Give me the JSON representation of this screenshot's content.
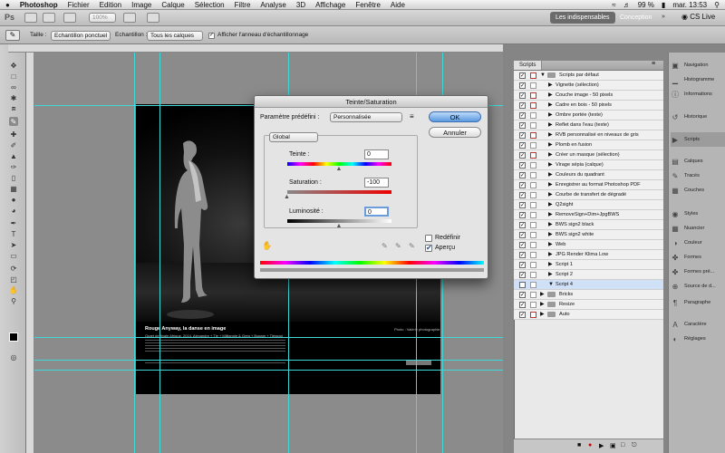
{
  "menubar": {
    "apple": "",
    "app": "Photoshop",
    "items": [
      "Fichier",
      "Edition",
      "Image",
      "Calque",
      "Sélection",
      "Filtre",
      "Analyse",
      "3D",
      "Affichage",
      "Fenêtre",
      "Aide"
    ],
    "battery": "99 %",
    "clock": "mar. 13:53"
  },
  "apptoolbar": {
    "ps_logo": "Ps",
    "zoom": "100%",
    "workspace_active": "Les indispensables",
    "workspace_other": "Conception",
    "more": "»",
    "cslive": "CS Live"
  },
  "options": {
    "size_label": "Taille :",
    "size_value": "Echantillon ponctuel",
    "sample_label": "Echantillon :",
    "sample_value": "Tous les calques",
    "ring_label": "Afficher l'anneau d'échantillonnage"
  },
  "document": {
    "caption_title": "Rouge Anyway, la danse en image",
    "caption_sub": "Quart de finale Afrique. 2014, Alexandre + Tie + Milliannie & Greg + Bogam + Tiéragui",
    "caption_right": "Photo : Valérie photographie"
  },
  "dialog": {
    "title": "Teinte/Saturation",
    "preset_label": "Paramètre prédéfini :",
    "preset_value": "Personnalisée",
    "ok": "OK",
    "cancel": "Annuler",
    "channel": "Global",
    "hue_label": "Teinte :",
    "hue_value": "0",
    "saturation_label": "Saturation :",
    "saturation_value": "-100",
    "lightness_label": "Luminosité :",
    "lightness_value": "0",
    "colorize_label": "Redéfinir",
    "preview_label": "Aperçu",
    "hue_slider": 0.5,
    "saturation_slider": 0,
    "lightness_slider": 0.5
  },
  "scripts": {
    "tab": "Scripts",
    "rows": [
      {
        "label": "Scripts par défaut",
        "level": 0,
        "type": "folder",
        "checked": true,
        "red": true
      },
      {
        "label": "Vignette (sélection)",
        "level": 1,
        "type": "item",
        "checked": true,
        "red": false
      },
      {
        "label": "Couche image - 50 pixels",
        "level": 1,
        "type": "item",
        "checked": true,
        "red": true
      },
      {
        "label": "Cadre en bois - 50 pixels",
        "level": 1,
        "type": "item",
        "checked": true,
        "red": true
      },
      {
        "label": "Ombre portée (texte)",
        "level": 1,
        "type": "item",
        "checked": true,
        "red": false
      },
      {
        "label": "Reflet dans l'eau (texte)",
        "level": 1,
        "type": "item",
        "checked": true,
        "red": false
      },
      {
        "label": "RVB personnalisé en niveaux de gris",
        "level": 1,
        "type": "item",
        "checked": true,
        "red": true
      },
      {
        "label": "Plomb en fusion",
        "level": 1,
        "type": "item",
        "checked": true,
        "red": false
      },
      {
        "label": "Créer un masque (sélection)",
        "level": 1,
        "type": "item",
        "checked": true,
        "red": true
      },
      {
        "label": "Virage sépia (calque)",
        "level": 1,
        "type": "item",
        "checked": true,
        "red": false
      },
      {
        "label": "Couleurs du quadrant",
        "level": 1,
        "type": "item",
        "checked": true,
        "red": false
      },
      {
        "label": "Enregistrer au format Photoshop PDF",
        "level": 1,
        "type": "item",
        "checked": true,
        "red": false
      },
      {
        "label": "Courbe de transfert de dégradé",
        "level": 1,
        "type": "item",
        "checked": true,
        "red": false
      },
      {
        "label": "Q2sight",
        "level": 1,
        "type": "item",
        "checked": true,
        "red": false
      },
      {
        "label": "RemoveSign+Dim+JpgBWS",
        "level": 1,
        "type": "item",
        "checked": true,
        "red": false
      },
      {
        "label": "BWS sign2 black",
        "level": 1,
        "type": "item",
        "checked": true,
        "red": false
      },
      {
        "label": "BWS sign2 white",
        "level": 1,
        "type": "item",
        "checked": true,
        "red": false
      },
      {
        "label": "Web",
        "level": 1,
        "type": "item",
        "checked": true,
        "red": false
      },
      {
        "label": "JPG Render Klima Low",
        "level": 1,
        "type": "item",
        "checked": true,
        "red": false
      },
      {
        "label": "Script 1",
        "level": 1,
        "type": "item",
        "checked": true,
        "red": false
      },
      {
        "label": "Script 2",
        "level": 1,
        "type": "item",
        "checked": true,
        "red": false
      },
      {
        "label": "Script 4",
        "level": 1,
        "type": "open",
        "checked": false,
        "red": false,
        "selected": true
      },
      {
        "label": "Bricks",
        "level": 0,
        "type": "folder",
        "checked": true,
        "red": false
      },
      {
        "label": "Resize",
        "level": 0,
        "type": "folder",
        "checked": true,
        "red": false
      },
      {
        "label": "Auto",
        "level": 0,
        "type": "folder",
        "checked": true,
        "red": true
      }
    ]
  },
  "dock": {
    "items": [
      {
        "label": "Navigation",
        "icon": "navigation-icon"
      },
      {
        "label": "Histogramme",
        "icon": "histogram-icon"
      },
      {
        "label": "Informations",
        "icon": "info-icon"
      },
      {
        "label": "Historique",
        "icon": "history-icon"
      },
      {
        "label": "Scripts",
        "icon": "scripts-icon"
      },
      {
        "label": "Calques",
        "icon": "layers-icon"
      },
      {
        "label": "Tracés",
        "icon": "paths-icon"
      },
      {
        "label": "Couches",
        "icon": "channels-icon"
      },
      {
        "label": "Styles",
        "icon": "styles-icon"
      },
      {
        "label": "Nuancier",
        "icon": "swatches-icon"
      },
      {
        "label": "Couleur",
        "icon": "color-icon"
      },
      {
        "label": "Formes",
        "icon": "shapes-icon"
      },
      {
        "label": "Formes pré...",
        "icon": "brush-presets-icon"
      },
      {
        "label": "Source de d...",
        "icon": "clone-source-icon"
      },
      {
        "label": "Paragraphe",
        "icon": "paragraph-icon"
      },
      {
        "label": "Caractère",
        "icon": "character-icon"
      },
      {
        "label": "Réglages",
        "icon": "adjustments-icon"
      }
    ]
  }
}
